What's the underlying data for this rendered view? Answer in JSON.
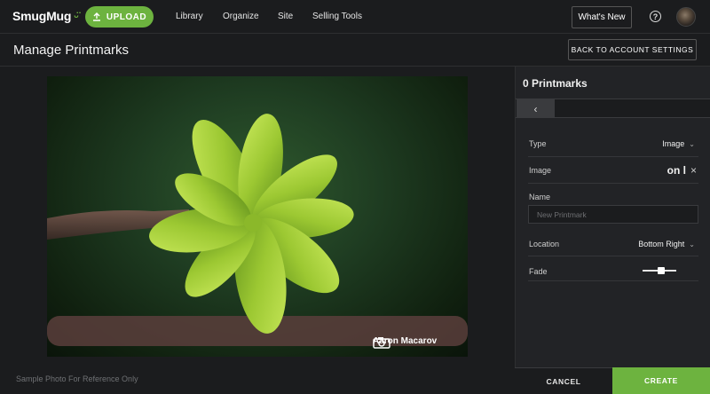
{
  "topbar": {
    "logo": "SmugMug",
    "upload_label": "UPLOAD",
    "nav": [
      "Library",
      "Organize",
      "Site",
      "Selling Tools"
    ],
    "whats_new_label": "What's New",
    "help_symbol": "?"
  },
  "page": {
    "title": "Manage Printmarks",
    "back_label": "BACK TO ACCOUNT SETTINGS"
  },
  "preview": {
    "watermark_text": "Aaron Macarov",
    "sample_note": "Sample Photo For Reference Only"
  },
  "panel": {
    "title": "0 Printmarks",
    "back_symbol": "‹",
    "type": {
      "label": "Type",
      "value": "Image"
    },
    "image": {
      "label": "Image",
      "value": "on l",
      "clear_symbol": "×"
    },
    "name": {
      "label": "Name",
      "placeholder": "New Printmark"
    },
    "location": {
      "label": "Location",
      "value": "Bottom Right"
    },
    "fade": {
      "label": "Fade",
      "level": 0.55
    },
    "cancel_label": "CANCEL",
    "create_label": "CREATE"
  },
  "colors": {
    "accent": "#6db33f",
    "background": "#1b1c1e",
    "panel": "#222326"
  },
  "icons": [
    "upload-icon",
    "help-icon",
    "avatar",
    "chevron-left-icon",
    "chevron-down-icon",
    "close-icon",
    "camera-icon"
  ]
}
